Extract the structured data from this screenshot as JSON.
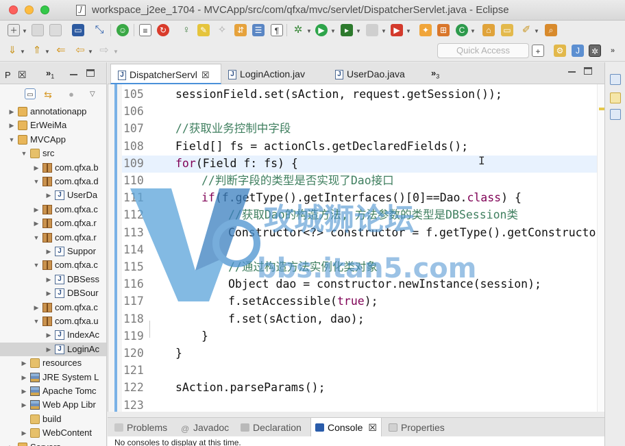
{
  "window": {
    "title": "workspace_j2ee_1704 - MVCApp/src/com/qfxa/mvc/servlet/DispatcherServlet.java - Eclipse",
    "file_icon": "J"
  },
  "toolbar": {
    "quick_access_placeholder": "Quick Access"
  },
  "package_explorer": {
    "tab_label": "P",
    "tab_close": "☒",
    "overflow_label": "»",
    "overflow_count": "1",
    "items": [
      {
        "label": "annotationapp",
        "icon": "project-icon",
        "twisty": "▶",
        "indent": 0
      },
      {
        "label": "ErWeiMa",
        "icon": "project-icon",
        "twisty": "▶",
        "indent": 0
      },
      {
        "label": "MVCApp",
        "icon": "project-icon",
        "twisty": "▼",
        "indent": 0
      },
      {
        "label": "src",
        "icon": "source-folder-icon",
        "twisty": "▼",
        "indent": 1
      },
      {
        "label": "com.qfxa.b",
        "icon": "package-icon",
        "twisty": "▶",
        "indent": 2
      },
      {
        "label": "com.qfxa.d",
        "icon": "package-icon",
        "twisty": "▼",
        "indent": 2
      },
      {
        "label": "UserDa",
        "icon": "java-file-icon",
        "twisty": "▶",
        "indent": 3
      },
      {
        "label": "com.qfxa.c",
        "icon": "package-icon",
        "twisty": "▶",
        "indent": 2
      },
      {
        "label": "com.qfxa.r",
        "icon": "package-icon",
        "twisty": "▶",
        "indent": 2
      },
      {
        "label": "com.qfxa.r",
        "icon": "package-icon",
        "twisty": "▼",
        "indent": 2
      },
      {
        "label": "Suppor",
        "icon": "java-file-icon",
        "twisty": "▶",
        "indent": 3
      },
      {
        "label": "com.qfxa.c",
        "icon": "package-icon",
        "twisty": "▼",
        "indent": 2
      },
      {
        "label": "DBSess",
        "icon": "java-file-icon",
        "twisty": "▶",
        "indent": 3
      },
      {
        "label": "DBSour",
        "icon": "java-file-icon",
        "twisty": "▶",
        "indent": 3
      },
      {
        "label": "com.qfxa.c",
        "icon": "package-icon",
        "twisty": "▶",
        "indent": 2
      },
      {
        "label": "com.qfxa.u",
        "icon": "package-icon",
        "twisty": "▼",
        "indent": 2
      },
      {
        "label": "IndexAc",
        "icon": "java-file-icon",
        "twisty": "▶",
        "indent": 3
      },
      {
        "label": "LoginAc",
        "icon": "java-file-icon",
        "twisty": "▶",
        "indent": 3,
        "selected": true
      },
      {
        "label": "resources",
        "icon": "folder-icon",
        "twisty": "▶",
        "indent": 1
      },
      {
        "label": "JRE System L",
        "icon": "library-icon",
        "twisty": "▶",
        "indent": 1
      },
      {
        "label": "Apache Tomc",
        "icon": "library-icon",
        "twisty": "▶",
        "indent": 1
      },
      {
        "label": "Web App Libr",
        "icon": "library-icon",
        "twisty": "▶",
        "indent": 1
      },
      {
        "label": "build",
        "icon": "folder-icon",
        "twisty": "",
        "indent": 1
      },
      {
        "label": "WebContent",
        "icon": "folder-icon",
        "twisty": "▶",
        "indent": 1
      },
      {
        "label": "Servers",
        "icon": "project-icon",
        "twisty": "▶",
        "indent": 0
      }
    ]
  },
  "editor": {
    "tabs": [
      {
        "label": "DispatcherServl",
        "active": true,
        "close": "☒"
      },
      {
        "label": "LoginAction.jav",
        "active": false
      },
      {
        "label": "UserDao.java",
        "active": false
      }
    ],
    "overflow_label": "»",
    "overflow_count": "3",
    "lines": [
      {
        "num": "105",
        "indent": 0,
        "parts": [
          {
            "t": "sessionField.set(sAction, request.getSession());",
            "c": ""
          }
        ]
      },
      {
        "num": "106",
        "indent": 0,
        "parts": []
      },
      {
        "num": "107",
        "indent": 0,
        "parts": [
          {
            "t": "//获取业务控制中字段",
            "c": "cm"
          }
        ]
      },
      {
        "num": "108",
        "indent": 0,
        "parts": [
          {
            "t": "Field[] fs = actionCls.getDeclaredFields();",
            "c": ""
          }
        ]
      },
      {
        "num": "109",
        "indent": 0,
        "parts": [
          {
            "t": "for",
            "c": "kw"
          },
          {
            "t": "(Field f: fs) {",
            "c": ""
          }
        ]
      },
      {
        "num": "110",
        "indent": 1,
        "parts": [
          {
            "t": "//判断字段的类型是否实现了Dao接口",
            "c": "cm"
          }
        ]
      },
      {
        "num": "111",
        "indent": 1,
        "parts": [
          {
            "t": "if",
            "c": "kw"
          },
          {
            "t": "(f.getType().getInterfaces()[0]==Dao.",
            "c": ""
          },
          {
            "t": "class",
            "c": "kw"
          },
          {
            "t": ") {",
            "c": ""
          }
        ]
      },
      {
        "num": "112",
        "indent": 2,
        "parts": [
          {
            "t": "//获取Dao的构造方法, 方法参数的类型是DBSession类",
            "c": "cm"
          }
        ]
      },
      {
        "num": "113",
        "indent": 2,
        "parts": [
          {
            "t": "Constructor<?> constructor = f.getType().getConstructor",
            "c": ""
          }
        ]
      },
      {
        "num": "114",
        "indent": 0,
        "parts": []
      },
      {
        "num": "115",
        "indent": 2,
        "parts": [
          {
            "t": "//通过构造方法实例化类对象",
            "c": "cm"
          }
        ]
      },
      {
        "num": "116",
        "indent": 2,
        "parts": [
          {
            "t": "Object dao = constructor.newInstance(session);",
            "c": ""
          }
        ]
      },
      {
        "num": "117",
        "indent": 2,
        "parts": [
          {
            "t": "f.setAccessible(",
            "c": ""
          },
          {
            "t": "true",
            "c": "kw"
          },
          {
            "t": ");",
            "c": ""
          }
        ]
      },
      {
        "num": "118",
        "indent": 2,
        "parts": [
          {
            "t": "f.set(sAction, dao);",
            "c": ""
          }
        ]
      },
      {
        "num": "119",
        "indent": 1,
        "parts": [
          {
            "t": "}",
            "c": ""
          }
        ]
      },
      {
        "num": "120",
        "indent": 0,
        "parts": [
          {
            "t": "}",
            "c": ""
          }
        ]
      },
      {
        "num": "121",
        "indent": 0,
        "parts": []
      },
      {
        "num": "122",
        "indent": 0,
        "parts": [
          {
            "t": "sAction.parseParams();",
            "c": ""
          }
        ]
      },
      {
        "num": "123",
        "indent": 0,
        "parts": []
      }
    ]
  },
  "bottom_panel": {
    "tabs": [
      {
        "label": "Problems",
        "icon": "problems-icon",
        "active": false
      },
      {
        "label": "Javadoc",
        "icon": "javadoc-icon",
        "active": false
      },
      {
        "label": "Declaration",
        "icon": "declaration-icon",
        "active": false
      },
      {
        "label": "Console",
        "icon": "console-icon",
        "active": true,
        "close": "☒"
      },
      {
        "label": "Properties",
        "icon": "properties-icon",
        "active": false
      }
    ],
    "message": "No consoles to display at this time."
  },
  "watermark": {
    "text_cn": "攻城狮论坛",
    "text_url": "bbs.itan5.com"
  }
}
